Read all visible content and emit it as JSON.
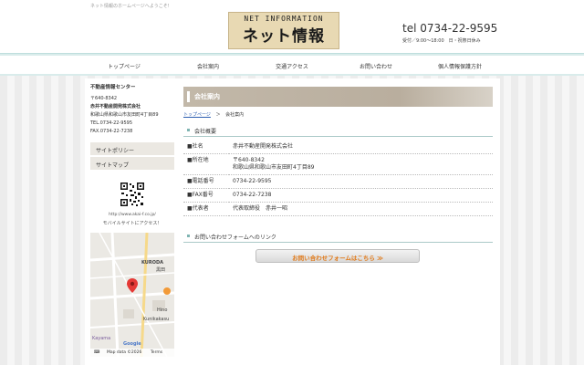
{
  "header": {
    "tagline": "ネット情報のホームページへようこそ!",
    "logo_top": "NET INFORMATION",
    "logo_main": "ネット情報",
    "tel": "tel 0734-22-9595",
    "hours": "受付／9:00〜18:00　日・祝祭日休み"
  },
  "nav": {
    "items": [
      {
        "label": "トップページ"
      },
      {
        "label": "会社案内"
      },
      {
        "label": "交通アクセス"
      },
      {
        "label": "お問い合わせ"
      },
      {
        "label": "個人情報保護方針"
      }
    ]
  },
  "sidebar": {
    "company_center": "不動産情報センター",
    "postal": "〒640-8342",
    "company_name": "赤井不動産開発株式会社",
    "address": "和歌山県和歌山市友田町4丁目89",
    "tel": "TEL.0734-22-9595",
    "fax": "FAX.0734-22-7238",
    "menu": [
      "サイトポリシー",
      "サイトマップ"
    ],
    "mobile_url": "http://www.akai-f.co.jp/",
    "mobile_note": "モバイルサイトにアクセス！"
  },
  "map": {
    "labels": [
      "KURODA",
      "黒田",
      "Hino",
      "Kunikakasu",
      "Kayama",
      "Google"
    ],
    "footer_data": "Map data ©2026",
    "footer_terms": "Terms"
  },
  "main": {
    "title": "会社案内",
    "breadcrumb_home": "トップページ",
    "breadcrumb_sep": "＞",
    "breadcrumb_current": "会社案内",
    "section1": "会社概要",
    "rows": [
      {
        "label": "■社名",
        "value": "赤井不動産開発株式会社",
        "value2": ""
      },
      {
        "label": "■所在地",
        "value": "〒640-8342",
        "value2": "和歌山県和歌山市友田町4丁目89"
      },
      {
        "label": "■電話番号",
        "value": "0734-22-9595",
        "value2": ""
      },
      {
        "label": "■FAX番号",
        "value": "0734-22-7238",
        "value2": ""
      },
      {
        "label": "■代表者",
        "value": "代表取締役　赤井一昭",
        "value2": ""
      }
    ],
    "section2": "お問い合わせフォームへのリンク",
    "contact_button": "お問い合わせフォームはこちら ≫"
  },
  "colors": {
    "accent_teal": "#d9eceb",
    "title_band": "#c2b8a9",
    "button_text": "#e07a1a",
    "link": "#2a5db0"
  }
}
